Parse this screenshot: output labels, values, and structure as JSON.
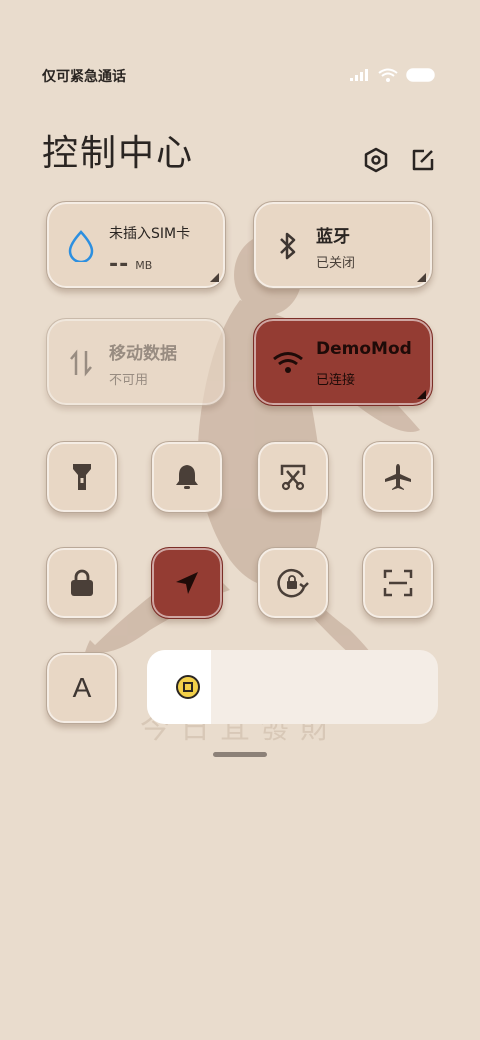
{
  "status_bar": {
    "carrier_text": "仅可紧急通话",
    "icons": [
      "signal-icon",
      "wifi-icon",
      "battery-icon"
    ]
  },
  "header": {
    "title": "控制中心",
    "icons": [
      "settings-hex-icon",
      "edit-icon"
    ]
  },
  "big_tiles": [
    {
      "name": "mobile-data-usage",
      "icon": "water-drop-icon",
      "title": "未插入SIM卡",
      "value": "--",
      "unit": "MB",
      "enabled": true,
      "active": false
    },
    {
      "name": "bluetooth",
      "icon": "bluetooth-icon",
      "title": "蓝牙",
      "subtitle": "已关闭",
      "enabled": true,
      "active": false
    },
    {
      "name": "mobile-data",
      "icon": "data-arrows-icon",
      "title": "移动数据",
      "subtitle": "不可用",
      "enabled": false,
      "active": false
    },
    {
      "name": "wifi",
      "icon": "wifi-icon",
      "title": "DemoMod",
      "subtitle": "已连接",
      "enabled": true,
      "active": true
    }
  ],
  "toggles": [
    {
      "name": "flashlight",
      "icon": "flashlight-icon",
      "active": false
    },
    {
      "name": "ring",
      "icon": "bell-icon",
      "active": false
    },
    {
      "name": "screenshot",
      "icon": "scissors-icon",
      "active": false
    },
    {
      "name": "airplane",
      "icon": "airplane-icon",
      "active": false
    },
    {
      "name": "lock-screen",
      "icon": "lock-icon",
      "active": false
    },
    {
      "name": "location",
      "icon": "navigation-arrow-icon",
      "active": true
    },
    {
      "name": "rotation-lock",
      "icon": "rotation-lock-icon",
      "active": false
    },
    {
      "name": "scanner",
      "icon": "scan-icon",
      "active": false
    },
    {
      "name": "font-size",
      "icon": "font-a-icon",
      "label": "A",
      "active": false
    }
  ],
  "brightness": {
    "level": 0.22,
    "icon": "coin-icon"
  },
  "wallpaper_caption": "今日宜發財",
  "colors": {
    "background": "#e9dccd",
    "tile": "#e8d7c5",
    "active": "#943c33",
    "text": "#2a2522"
  }
}
